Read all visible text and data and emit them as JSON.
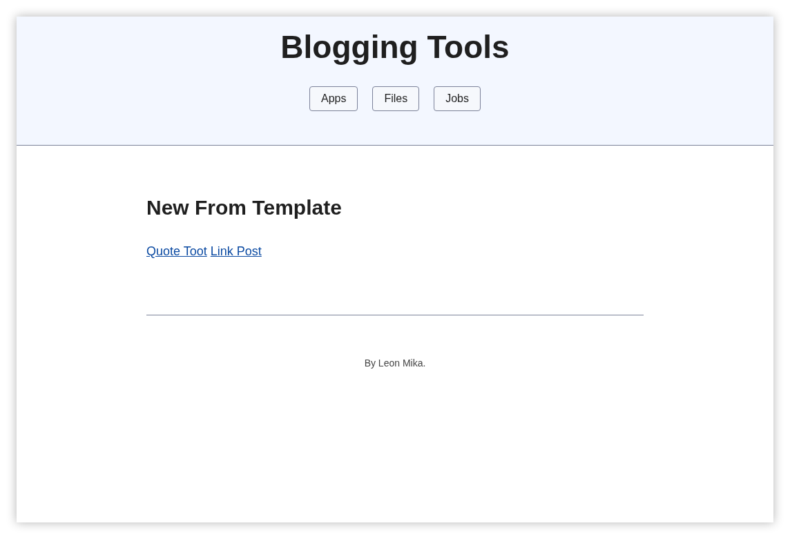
{
  "header": {
    "title": "Blogging Tools",
    "nav": [
      "Apps",
      "Files",
      "Jobs"
    ]
  },
  "main": {
    "heading": "New From Template",
    "links": [
      "Quote Toot",
      "Link Post"
    ]
  },
  "footer": {
    "text": "By Leon Mika."
  }
}
